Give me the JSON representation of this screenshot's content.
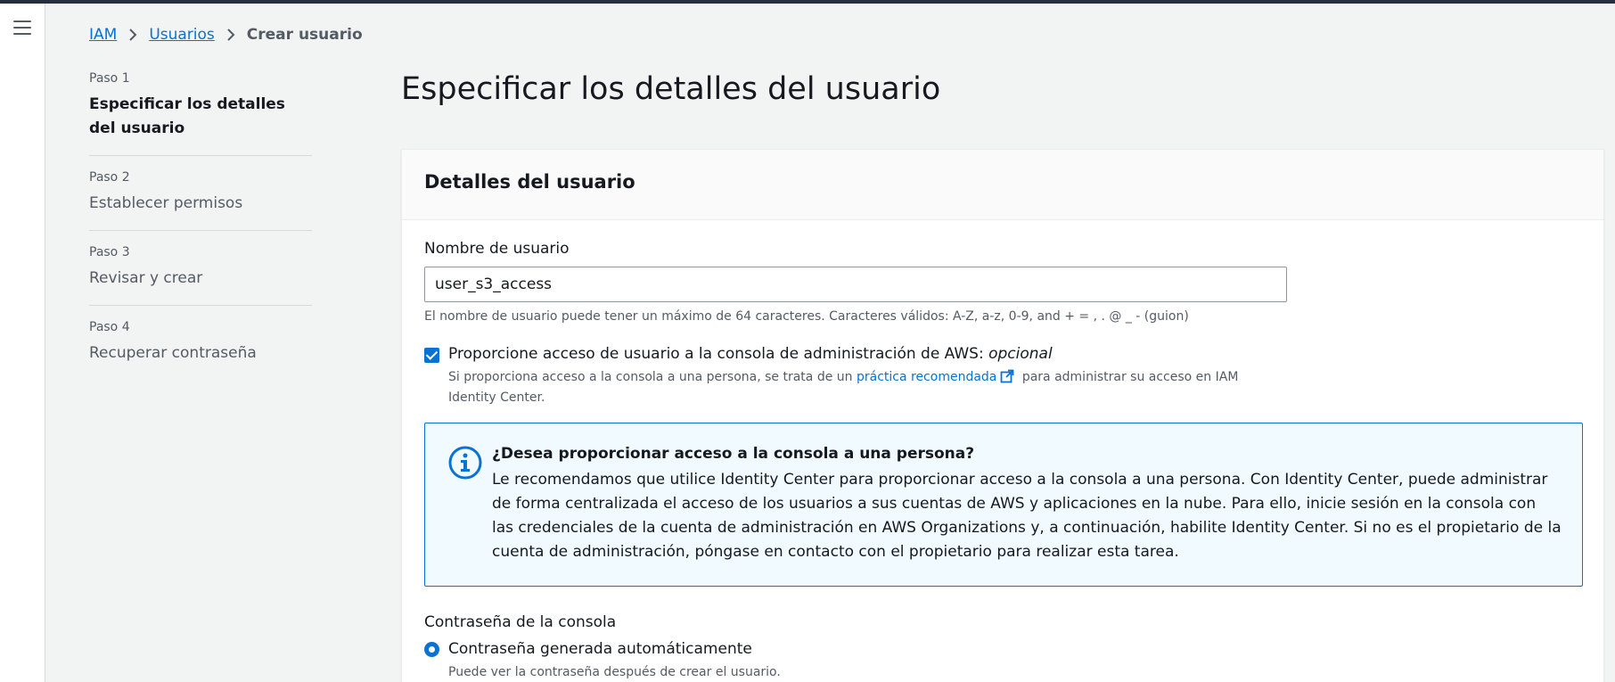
{
  "breadcrumb": {
    "items": [
      "IAM",
      "Usuarios"
    ],
    "current": "Crear usuario"
  },
  "steps": [
    {
      "num": "Paso 1",
      "title": "Especificar los detalles del usuario"
    },
    {
      "num": "Paso 2",
      "title": "Establecer permisos"
    },
    {
      "num": "Paso 3",
      "title": "Revisar y crear"
    },
    {
      "num": "Paso 4",
      "title": "Recuperar contraseña"
    }
  ],
  "page": {
    "title": "Especificar los detalles del usuario"
  },
  "user_details": {
    "header": "Detalles del usuario",
    "username_label": "Nombre de usuario",
    "username_value": "user_s3_access",
    "username_hint": "El nombre de usuario puede tener un máximo de 64 caracteres. Caracteres válidos: A-Z, a-z, 0-9, and + = , . @ _ - (guion)",
    "console_access_label": "Proporcione acceso de usuario a la consola de administración de AWS:",
    "console_access_optional": "opcional",
    "console_access_checked": true,
    "console_desc_pre": "Si proporciona acceso a la consola a una persona, se trata de un",
    "console_desc_link": "práctica recomendada",
    "console_desc_post": "para administrar su acceso en IAM Identity Center."
  },
  "alert": {
    "title": "¿Desea proporcionar acceso a la consola a una persona?",
    "text": "Le recomendamos que utilice Identity Center para proporcionar acceso a la consola a una persona. Con Identity Center, puede administrar de forma centralizada el acceso de los usuarios a sus cuentas de AWS y aplicaciones en la nube. Para ello, inicie sesión en la consola con las credenciales de la cuenta de administración en AWS Organizations y, a continuación, habilite Identity Center. Si no es el propietario de la cuenta de administración, póngase en contacto con el propietario para realizar esta tarea."
  },
  "password": {
    "label": "Contraseña de la consola",
    "option_label": "Contraseña generada automáticamente",
    "option_desc": "Puede ver la contraseña después de crear el usuario.",
    "option_selected": true
  },
  "colors": {
    "accent": "#0972d3",
    "alert_bg": "#f1faff"
  }
}
